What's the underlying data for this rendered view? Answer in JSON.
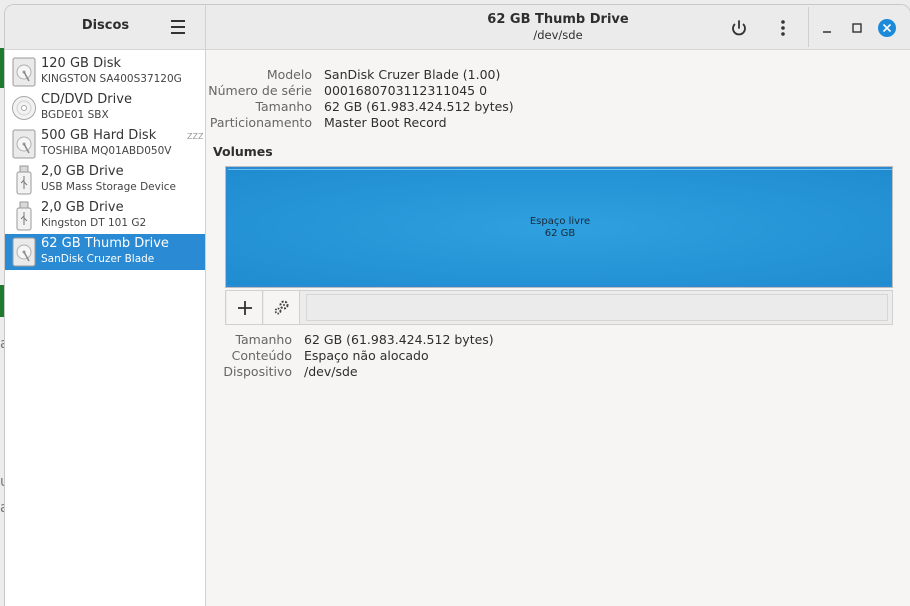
{
  "background": {
    "ghost_lines": [
      "a",
      "u",
      "a"
    ],
    "accent": "#1e7a2e"
  },
  "sidebar": {
    "title": "Discos",
    "menu_icon": "hamburger-icon",
    "items": [
      {
        "name": "120 GB Disk",
        "model": "KINGSTON SA400S37120G",
        "icon": "hard-disk-icon",
        "selected": false
      },
      {
        "name": "CD/DVD Drive",
        "model": "BGDE01 SBX",
        "icon": "optical-disc-icon",
        "selected": false
      },
      {
        "name": "500 GB Hard Disk",
        "model": "TOSHIBA MQ01ABD050V",
        "icon": "hard-disk-icon",
        "selected": false,
        "sleeping": "ZZZ"
      },
      {
        "name": "2,0 GB Drive",
        "model": "USB Mass Storage Device",
        "icon": "usb-drive-icon",
        "selected": false
      },
      {
        "name": "2,0 GB Drive",
        "model": "Kingston DT 101 G2",
        "icon": "usb-drive-icon",
        "selected": false
      },
      {
        "name": "62 GB Thumb Drive",
        "model": "SanDisk Cruzer Blade",
        "icon": "hard-disk-icon",
        "selected": true
      }
    ]
  },
  "header": {
    "title": "62 GB Thumb Drive",
    "subtitle": "/dev/sde",
    "power_icon": "power-icon",
    "more_icon": "more-vertical-icon",
    "minimize_icon": "minimize-icon",
    "maximize_icon": "maximize-icon",
    "close_icon": "close-icon",
    "close_color": "#1c8ad9"
  },
  "details": {
    "model_label": "Modelo",
    "model_value": "SanDisk Cruzer Blade (1.00)",
    "serial_label": "Número de série",
    "serial_value": "0001680703112311045 0",
    "size_label": "Tamanho",
    "size_value": "62 GB (61.983.424.512 bytes)",
    "partitioning_label": "Particionamento",
    "partitioning_value": "Master Boot Record"
  },
  "volumes": {
    "title": "Volumes",
    "segment_label": "Espaço livre",
    "segment_size": "62 GB",
    "segment_color": "#2a8bd4",
    "add_icon": "plus-icon",
    "options_icon": "gears-icon"
  },
  "volume_details": {
    "size_label": "Tamanho",
    "size_value": "62 GB (61.983.424.512 bytes)",
    "content_label": "Conteúdo",
    "content_value": "Espaço não alocado",
    "device_label": "Dispositivo",
    "device_value": "/dev/sde"
  }
}
